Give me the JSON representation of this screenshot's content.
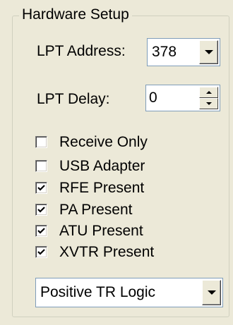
{
  "group": {
    "title": "Hardware Setup"
  },
  "lpt_address": {
    "label": "LPT Address:",
    "value": "378"
  },
  "lpt_delay": {
    "label": "LPT Delay:",
    "value": "0"
  },
  "options": [
    {
      "label": "Receive Only",
      "checked": false
    },
    {
      "label": "USB Adapter",
      "checked": false
    },
    {
      "label": "RFE Present",
      "checked": true
    },
    {
      "label": "PA Present",
      "checked": true
    },
    {
      "label": "ATU Present",
      "checked": true
    },
    {
      "label": "XVTR Present",
      "checked": true
    }
  ],
  "tr_logic": {
    "value": "Positive TR Logic"
  },
  "icons": {
    "dropdown": "chevron-down-icon",
    "spin_up": "arrow-up-icon",
    "spin_down": "arrow-down-icon",
    "check": "checkmark-icon"
  }
}
